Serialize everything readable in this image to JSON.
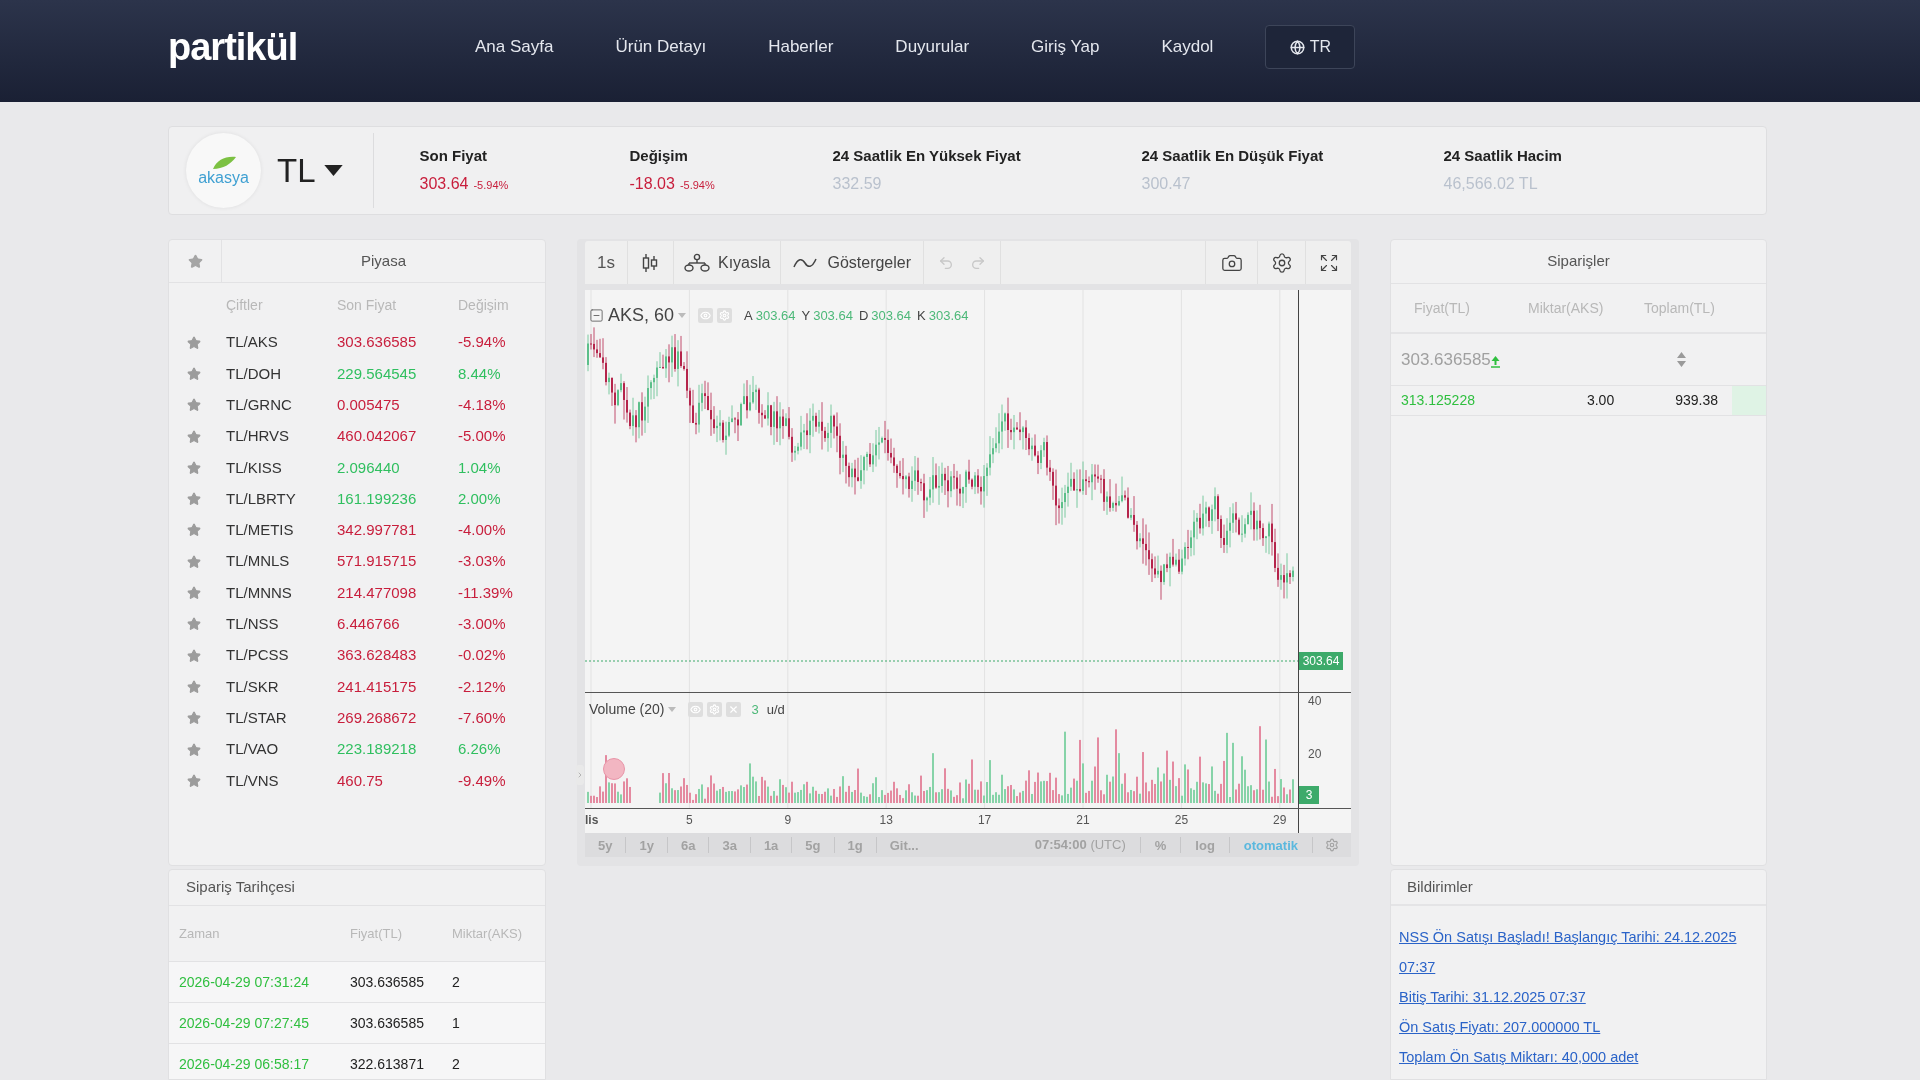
{
  "header": {
    "logo": "partikül",
    "nav": [
      "Ana Sayfa",
      "Ürün Detayı",
      "Haberler",
      "Duyurular",
      "Giriş Yap",
      "Kaydol"
    ],
    "language": "TR"
  },
  "ticker": {
    "logo": "akasya",
    "currency": "TL",
    "stats": [
      {
        "label": "Son Fiyat",
        "value": "303.64",
        "change": "-5.94%",
        "color": "#c81e3c"
      },
      {
        "label": "Değişim",
        "value": "-18.03",
        "change": "-5.94%",
        "color": "#c81e3c"
      },
      {
        "label": "24 Saatlik En Yüksek Fiyat",
        "value": "332.59",
        "color": "#b9c1cd"
      },
      {
        "label": "24 Saatlik En Düşük Fiyat",
        "value": "300.47",
        "color": "#b9c1cd"
      },
      {
        "label": "24 Saatlik Hacim",
        "value": "46,566.02 TL",
        "color": "#b9c1cd"
      }
    ]
  },
  "market": {
    "title": "Piyasa",
    "columns": [
      "Çiftler",
      "Son Fiyat",
      "Değişim"
    ],
    "rows": [
      {
        "pair": "TL/AKS",
        "price": "303.636585",
        "change": "-5.94%",
        "color": "#c81e3c",
        "starred": false
      },
      {
        "pair": "TL/DOH",
        "price": "229.564545",
        "change": "8.44%",
        "color": "#2fbf5f",
        "starred": false
      },
      {
        "pair": "TL/GRNC",
        "price": "0.005475",
        "change": "-4.18%",
        "color": "#c81e3c",
        "starred": false
      },
      {
        "pair": "TL/HRVS",
        "price": "460.042067",
        "change": "-5.00%",
        "color": "#c81e3c",
        "starred": false
      },
      {
        "pair": "TL/KISS",
        "price": "2.096440",
        "change": "1.04%",
        "color": "#2fbf5f",
        "starred": false
      },
      {
        "pair": "TL/LBRTY",
        "price": "161.199236",
        "change": "2.00%",
        "color": "#2fbf5f",
        "starred": false
      },
      {
        "pair": "TL/METIS",
        "price": "342.997781",
        "change": "-4.00%",
        "color": "#c81e3c",
        "starred": false
      },
      {
        "pair": "TL/MNLS",
        "price": "571.915715",
        "change": "-3.03%",
        "color": "#c81e3c",
        "starred": false
      },
      {
        "pair": "TL/MNNS",
        "price": "214.477098",
        "change": "-11.39%",
        "color": "#c81e3c",
        "starred": false
      },
      {
        "pair": "TL/NSS",
        "price": "6.446766",
        "change": "-3.00%",
        "color": "#c81e3c",
        "starred": false
      },
      {
        "pair": "TL/PCSS",
        "price": "363.628483",
        "change": "-0.02%",
        "color": "#c81e3c",
        "starred": false
      },
      {
        "pair": "TL/SKR",
        "price": "241.415175",
        "change": "-2.12%",
        "color": "#c81e3c",
        "starred": false
      },
      {
        "pair": "TL/STAR",
        "price": "269.268672",
        "change": "-7.60%",
        "color": "#c81e3c",
        "starred": false
      },
      {
        "pair": "TL/VAO",
        "price": "223.189218",
        "change": "6.26%",
        "color": "#2fbf5f",
        "starred": false
      },
      {
        "pair": "TL/VNS",
        "price": "460.75",
        "change": "-9.49%",
        "color": "#c81e3c",
        "starred": false
      }
    ]
  },
  "chart": {
    "toolbar": {
      "interval": "1s",
      "compare": "Kıyasla",
      "indicators": "Göstergeler",
      "undo_disabled": true,
      "redo_disabled": true
    },
    "legend": {
      "symbol": "AKS, 60",
      "values": [
        {
          "label": "A",
          "value": "303.64"
        },
        {
          "label": "Y",
          "value": "303.64"
        },
        {
          "label": "D",
          "value": "303.64"
        },
        {
          "label": "K",
          "value": "303.64"
        }
      ]
    },
    "last_price": "303.64",
    "volume_legend": {
      "title": "Volume (20)",
      "value": "3",
      "unit": "u/d"
    },
    "volume_axis": [
      "40",
      "20"
    ],
    "volume_last": "3",
    "x_labels": [
      "lis",
      "5",
      "9",
      "13",
      "17",
      "21",
      "25",
      "29"
    ],
    "ranges": [
      {
        "label": "5y",
        "selected": false
      },
      {
        "label": "1y",
        "selected": false
      },
      {
        "label": "6a",
        "selected": false
      },
      {
        "label": "3a",
        "selected": false
      },
      {
        "label": "1a",
        "selected": false
      },
      {
        "label": "5g",
        "selected": false
      },
      {
        "label": "1g",
        "selected": false
      }
    ],
    "goto": "Git...",
    "time": "**07:54:00** (UTC)",
    "toggles": [
      {
        "label": "%",
        "on": false
      },
      {
        "label": "log",
        "on": false
      },
      {
        "label": "otomatik",
        "on": true
      }
    ]
  },
  "orders": {
    "title": "Siparişler",
    "columns": [
      "Fiyat(TL)",
      "Miktar(AKS)",
      "Toplam(TL)"
    ],
    "current": {
      "price": "303.636585",
      "color": "#2fbf3f"
    },
    "rows": [
      {
        "price": "313.125228",
        "amount": "3.00",
        "total": "939.38",
        "color": "#2fbf3f",
        "level": 0.09
      }
    ]
  },
  "order_history": {
    "title": "Sipariş Tarihçesi",
    "columns": [
      "Zaman",
      "Fiyat(TL)",
      "Miktar(AKS)"
    ],
    "rows": [
      {
        "time": "2026-04-29 07:31:24",
        "price": "303.636585",
        "amount": "2",
        "color": "#2fbf3f"
      },
      {
        "time": "2026-04-29 07:27:45",
        "price": "303.636585",
        "amount": "1",
        "color": "#2fbf3f"
      },
      {
        "time": "2026-04-29 06:58:17",
        "price": "322.613871",
        "amount": "2",
        "color": "#2fbf3f"
      }
    ]
  },
  "notifications": {
    "title": "Bildirimler",
    "items": [
      "NSS Ön Satışı Başladı! Başlangıç Tarihi: 24.12.2025 07:37",
      "Bitiş Tarihi: 31.12.2025 07:37",
      "Ön Satış Fiyatı: 207.000000 TL",
      "Toplam Ön Satış Miktarı: 40,000 adet"
    ]
  }
}
